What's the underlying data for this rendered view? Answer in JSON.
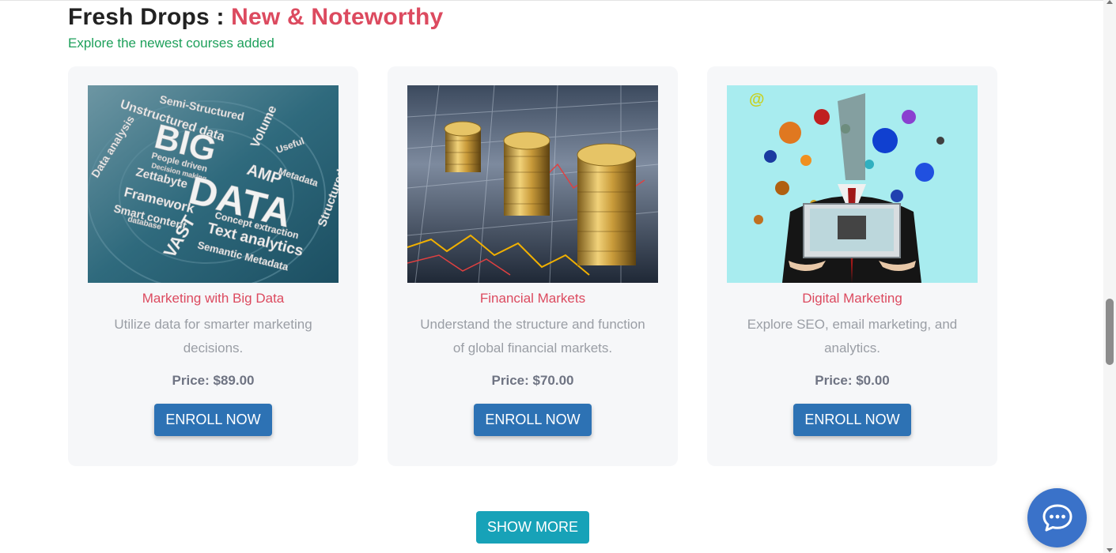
{
  "section": {
    "title_prefix": "Fresh Drops : ",
    "title_accent": "New & Noteworthy",
    "subtitle": "Explore the newest courses added"
  },
  "courses": [
    {
      "title": "Marketing with Big Data",
      "description": "Utilize data for smarter marketing decisions.",
      "price": "Price: $89.00",
      "button": "ENROLL NOW",
      "image_icon": "big-data-word-cloud",
      "image_words": [
        "BIG",
        "DATA",
        "Semi-Structured",
        "Unstructured data",
        "Volume",
        "Useful",
        "AMP",
        "Metadata",
        "Data analysis",
        "People driven",
        "Decision making",
        "Zettabyte",
        "Framework",
        "Structured",
        "Smart content",
        "database",
        "VAST",
        "Concept extraction",
        "Text analytics",
        "Semantic Metadata"
      ]
    },
    {
      "title": "Financial Markets",
      "description": "Understand the structure and function of global financial markets.",
      "price": "Price: $70.00",
      "button": "ENROLL NOW",
      "image_icon": "coin-stacks-chart"
    },
    {
      "title": "Digital Marketing",
      "description": "Explore SEO, email marketing, and analytics.",
      "price": "Price: $0.00",
      "button": "ENROLL NOW",
      "image_icon": "businessman-laptop-splash",
      "image_symbol": "@"
    }
  ],
  "show_more": "SHOW MORE",
  "chat": {
    "icon": "chat-bubble-icon"
  },
  "colors": {
    "accent_red": "#dc4a5f",
    "subtitle_green": "#1ea05b",
    "button_blue": "#2d72b4",
    "show_more_teal": "#17a2b8",
    "chat_blue": "#3a72c9"
  }
}
